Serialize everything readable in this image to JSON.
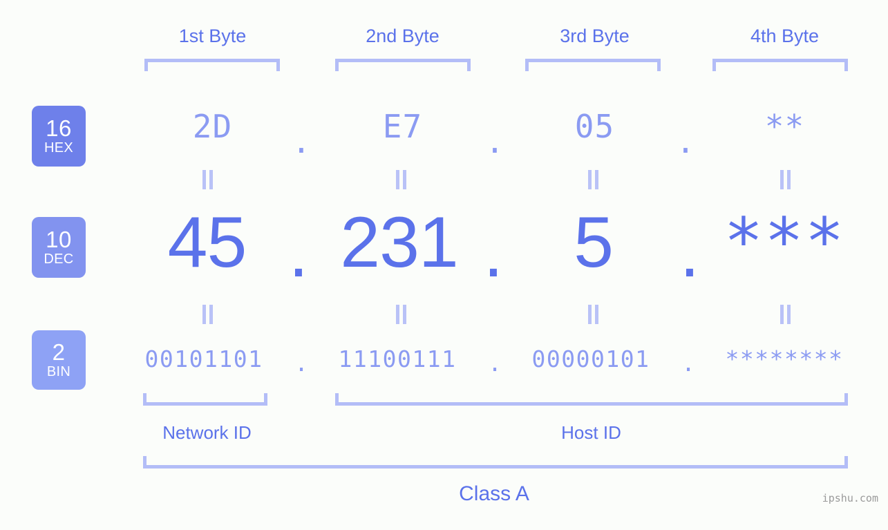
{
  "page": {
    "background": "#fbfdfa",
    "accent_strong": "#5b72ea",
    "accent_mid": "#8b9bf2",
    "accent_light": "#b3bdf7",
    "watermark": "ipshu.com"
  },
  "byte_headers": [
    {
      "label": "1st Byte"
    },
    {
      "label": "2nd Byte"
    },
    {
      "label": "3rd Byte"
    },
    {
      "label": "4th Byte"
    }
  ],
  "radix_badges": [
    {
      "number": "16",
      "name": "HEX",
      "color": "#6e80ea"
    },
    {
      "number": "10",
      "name": "DEC",
      "color": "#8293ef"
    },
    {
      "number": "2",
      "name": "BIN",
      "color": "#8ea2f5"
    }
  ],
  "rows": {
    "hex": {
      "values": [
        "2D",
        "E7",
        "05",
        "**"
      ],
      "separator": "."
    },
    "dec": {
      "values": [
        "45",
        "231",
        "5",
        "***"
      ],
      "separator": "."
    },
    "bin": {
      "values": [
        "00101101",
        "11100111",
        "00000101",
        "********"
      ],
      "separator": "."
    }
  },
  "equals_symbol": "=",
  "sections": [
    {
      "label": "Network ID"
    },
    {
      "label": "Host ID"
    }
  ],
  "class": {
    "label": "Class A"
  },
  "address": {
    "hex": "2D.E7.05.**",
    "dec": "45.231.5.***",
    "bin": "00101101.11100111.00000101.********"
  }
}
